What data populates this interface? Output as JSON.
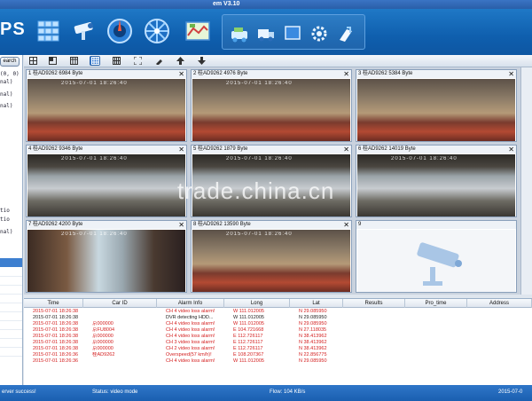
{
  "window": {
    "title": "em V3.10"
  },
  "topbar": {
    "logo": "PS",
    "buttons": [
      {
        "name": "grid-view-icon",
        "color": "#9fd0ff"
      },
      {
        "name": "camera-icon",
        "color": "#e8f3ff"
      },
      {
        "name": "playback-icon",
        "color": "#4a9bf0"
      },
      {
        "name": "track-icon",
        "color": "#4a9bf0"
      },
      {
        "name": "map-icon",
        "color": "#8ad06a"
      }
    ],
    "group_buttons": [
      "vehicle-icon",
      "truck-icon",
      "screen-icon",
      "settings-icon",
      "tools-icon"
    ]
  },
  "left_panel": {
    "search_label": "earch",
    "tree_items": [
      "(0, 0)",
      "nal)",
      "nal)",
      "nal)",
      "",
      "",
      "",
      "",
      "tio",
      "tio",
      "nal)"
    ]
  },
  "layout_toolbar": {
    "buttons": [
      "layout-1x1-icon",
      "layout-2x2-icon",
      "layout-3-icon",
      "layout-4-icon",
      "layout-3x3-icon",
      "layout-4x4-icon",
      "fullscreen-icon",
      "snapshot-icon",
      "up-arrow-icon",
      "down-arrow-icon"
    ],
    "active_index": 3
  },
  "channels": [
    {
      "id": "1",
      "title": "1 桂AD9262   6984 Byte",
      "osd": "2015-07-01 18:26:40",
      "scene": "bus"
    },
    {
      "id": "2",
      "title": "2 桂AD9262   4976 Byte",
      "osd": "2015-07-01 18:26:40",
      "scene": "bus"
    },
    {
      "id": "3",
      "title": "3 桂AD9262   5384 Byte",
      "osd": "",
      "scene": "bus"
    },
    {
      "id": "4",
      "title": "4 桂AD9262   9346 Byte",
      "osd": "2015-07-01 18:26:40",
      "scene": "road"
    },
    {
      "id": "5",
      "title": "5 桂AD9262   1879 Byte",
      "osd": "2015-07-01 18:26:40",
      "scene": "road"
    },
    {
      "id": "6",
      "title": "6 桂AD9262   14019 Byte",
      "osd": "2015-07-01 18:26:40",
      "scene": "road"
    },
    {
      "id": "7",
      "title": "7 桂AD9262   4200 Byte",
      "osd": "2015-07-01 18:26:40",
      "scene": "driver"
    },
    {
      "id": "8",
      "title": "8 桂AD9262   13590 Byte",
      "osd": "2015-07-01 18:26:40",
      "scene": "bus"
    },
    {
      "id": "9",
      "title": "9",
      "osd": "",
      "scene": "empty"
    }
  ],
  "alarm_table": {
    "columns": [
      "Time",
      "Car ID",
      "Alarm Info",
      "Long",
      "Lat",
      "Results",
      "Pro_time",
      "Address"
    ],
    "rows": [
      {
        "time": "2015-07-01 18:26:38",
        "car": "",
        "info": "CH 4 video loss alarm!",
        "long": "W 111.012005",
        "lat": "N 29.085950",
        "color": "#d42020"
      },
      {
        "time": "2015-07-01 18:26:38",
        "car": "",
        "info": "DVR detecting HDD...",
        "long": "W 111.012005",
        "lat": "N 29.085950",
        "color": "#222222"
      },
      {
        "time": "2015-07-01 18:26:38",
        "car": "京000000",
        "info": "CH 4 video loss alarm!",
        "long": "W 111.012005",
        "lat": "N 29.085950",
        "color": "#d42020"
      },
      {
        "time": "2015-07-01 18:26:38",
        "car": "京FU8004",
        "info": "CH 4 video loss alarm!",
        "long": "E 104.721668",
        "lat": "N 27.118035",
        "color": "#d42020"
      },
      {
        "time": "2015-07-01 18:26:38",
        "car": "京000000",
        "info": "CH 4 video loss alarm!",
        "long": "E 112.726117",
        "lat": "N 38.413962",
        "color": "#d42020"
      },
      {
        "time": "2015-07-01 18:26:38",
        "car": "京000000",
        "info": "CH 3 video loss alarm!",
        "long": "E 112.726117",
        "lat": "N 38.413962",
        "color": "#d42020"
      },
      {
        "time": "2015-07-01 18:26:38",
        "car": "京000000",
        "info": "CH 2 video loss alarm!",
        "long": "E 112.726117",
        "lat": "N 38.413962",
        "color": "#d42020"
      },
      {
        "time": "2015-07-01 18:26:36",
        "car": "桂AD9262",
        "info": "Overspeed(57 km/h)!",
        "long": "E 108.207367",
        "lat": "N 22.856775",
        "color": "#d42020"
      },
      {
        "time": "2015-07-01 18:26:36",
        "car": "",
        "info": "CH 4 video loss alarm!",
        "long": "W 111.012005",
        "lat": "N 29.085950",
        "color": "#d42020"
      }
    ]
  },
  "statusbar": {
    "left": "erver success!",
    "status": "Status: video mode",
    "flow": "Flow: 104 KB/s",
    "right": "2015-07-0"
  },
  "watermark": "trade.china.cn"
}
